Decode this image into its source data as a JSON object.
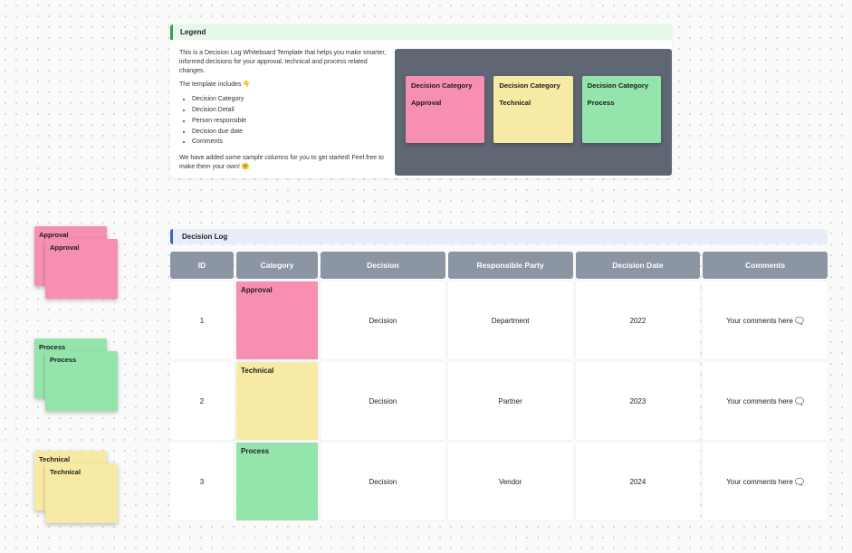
{
  "colors": {
    "pink": "#f78fb0",
    "yellow": "#f7eaa5",
    "green": "#93e5ab"
  },
  "legend": {
    "title": "Legend",
    "intro": "This is a Decision Log Whiteboard Template that helps you make smarter, informed decisions for your approval, technical and process related changes.",
    "includes_label": "The template includes 👇",
    "bullets": {
      "b0": "Decision Category",
      "b1": "Decision Detail",
      "b2": "Person responsible",
      "b3": "Decision due date",
      "b4": "Comments"
    },
    "footer": "We have added some sample columns for you to get started! Feel free to make them your own! 🤗",
    "swatches": {
      "header": "Decision Category",
      "s0": "Approval",
      "s1": "Technical",
      "s2": "Process"
    }
  },
  "side": {
    "g0": "Approval",
    "g1": "Process",
    "g2": "Technical"
  },
  "log": {
    "title": "Decision Log",
    "headers": {
      "h0": "ID",
      "h1": "Category",
      "h2": "Decision",
      "h3": "Responsible Party",
      "h4": "Decision Date",
      "h5": "Comments"
    },
    "rows": {
      "r0": {
        "id": "1",
        "category": "Approval",
        "decision": "Decision",
        "party": "Department",
        "date": "2022",
        "comments": "Your comments here 🗨️"
      },
      "r1": {
        "id": "2",
        "category": "Technical",
        "decision": "Decision",
        "party": "Partner",
        "date": "2023",
        "comments": "Your comments here 🗨️"
      },
      "r2": {
        "id": "3",
        "category": "Process",
        "decision": "Decision",
        "party": "Vendor",
        "date": "2024",
        "comments": "Your comments here 🗨️"
      }
    }
  }
}
